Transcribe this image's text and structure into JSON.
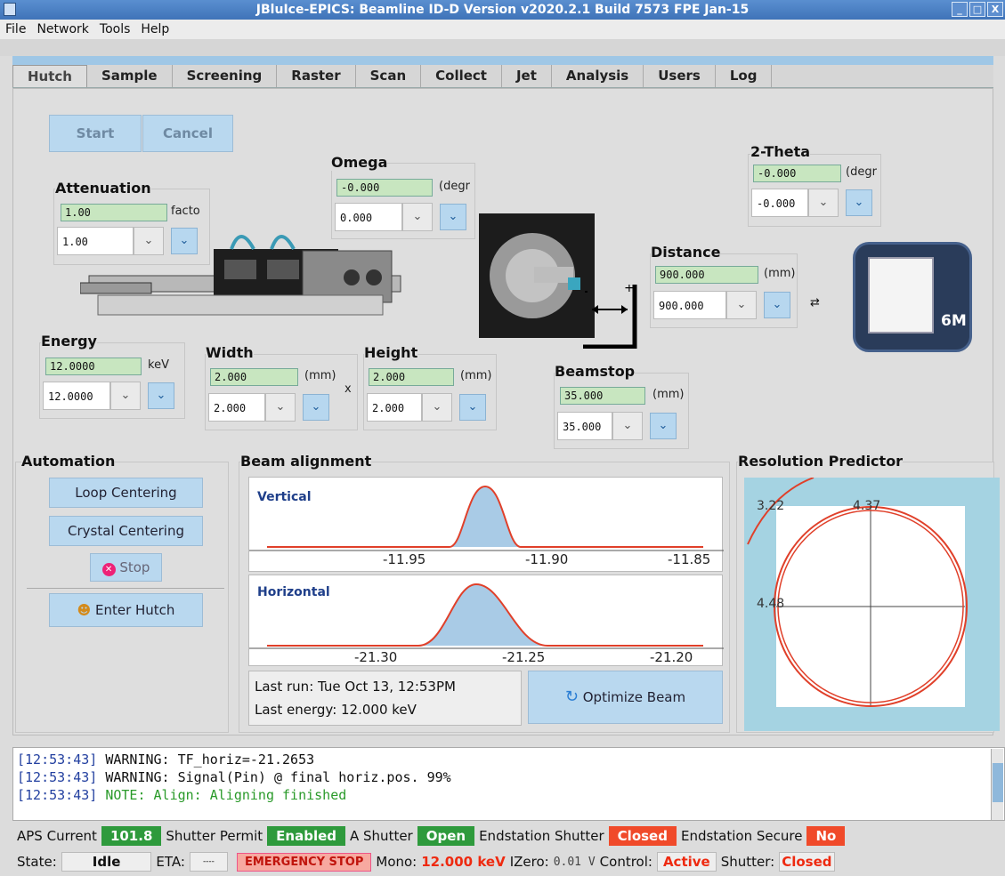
{
  "window": {
    "title": "JBluIce-EPICS: Beamline ID-D Version v2020.2.1 Build 7573 FPE Jan-15",
    "buttons": [
      "_",
      "□",
      "X"
    ]
  },
  "menu": [
    "File",
    "Network",
    "Tools",
    "Help"
  ],
  "tabs": [
    "Hutch",
    "Sample",
    "Screening",
    "Raster",
    "Scan",
    "Collect",
    "Jet",
    "Analysis",
    "Users",
    "Log"
  ],
  "hutch": {
    "start": "Start",
    "cancel": "Cancel",
    "attenuation": {
      "label": "Attenuation",
      "value": "1.00",
      "unit": "facto",
      "combo": "1.00"
    },
    "omega": {
      "label": "Omega",
      "value": "-0.000",
      "unit": "(degr",
      "combo": "0.000"
    },
    "two_theta": {
      "label": "2-Theta",
      "value": "-0.000",
      "unit": "(degr",
      "combo": "-0.000"
    },
    "distance": {
      "label": "Distance",
      "value": "900.000",
      "unit": "(mm)",
      "combo": "900.000"
    },
    "energy": {
      "label": "Energy",
      "value": "12.0000",
      "unit": "keV",
      "combo": "12.0000"
    },
    "width": {
      "label": "Width",
      "value": "2.000",
      "unit": "(mm)",
      "combo": "2.000"
    },
    "height": {
      "label": "Height",
      "value": "2.000",
      "unit": "(mm)",
      "combo": "2.000"
    },
    "times": "x",
    "beamstop": {
      "label": "Beamstop",
      "value": "35.000",
      "unit": "(mm)",
      "combo": "35.000"
    },
    "detector_badge": "6M"
  },
  "automation": {
    "label": "Automation",
    "loop": "Loop Centering",
    "crystal": "Crystal Centering",
    "stop": "Stop",
    "enter": "Enter Hutch"
  },
  "beam": {
    "label": "Beam alignment",
    "vertical": "Vertical",
    "horizontal": "Horizontal",
    "v_ticks": [
      "-11.95",
      "-11.90",
      "-11.85"
    ],
    "h_ticks": [
      "-21.30",
      "-21.25",
      "-21.20"
    ],
    "last_run": "Last run: Tue Oct 13, 12:53PM",
    "last_energy": "Last energy: 12.000 keV",
    "optimize": "Optimize Beam"
  },
  "resolution": {
    "label": "Resolution Predictor",
    "r1": "3.22",
    "r2": "4.37",
    "r3": "4.48"
  },
  "log": [
    {
      "time": "[12:53:43]",
      "msg": " WARNING:  TF_horiz=-21.2653",
      "kind": "warn"
    },
    {
      "time": "[12:53:43]",
      "msg": " WARNING: Signal(Pin) @ final horiz.pos. 99%",
      "kind": "warn"
    },
    {
      "time": "[12:53:43]",
      "msg": " NOTE: Align: Aligning finished",
      "kind": "note"
    }
  ],
  "status1": {
    "aps_label": "APS Current",
    "aps": "101.8",
    "permit_label": "Shutter Permit",
    "permit": "Enabled",
    "ash_label": "A Shutter",
    "ash": "Open",
    "end_label": "Endstation Shutter",
    "end": "Closed",
    "secure_label": "Endstation Secure",
    "secure": "No"
  },
  "status2": {
    "state_label": "State:",
    "state": "Idle",
    "eta_label": "ETA:",
    "eta": "----",
    "emergency": "EMERGENCY STOP",
    "mono_label": "Mono:",
    "mono": "12.000 keV",
    "izero_label": "IZero:",
    "izero": "0.01 V",
    "control_label": "Control:",
    "control": "Active",
    "shutter_label": "Shutter:",
    "shutter": "Closed"
  }
}
